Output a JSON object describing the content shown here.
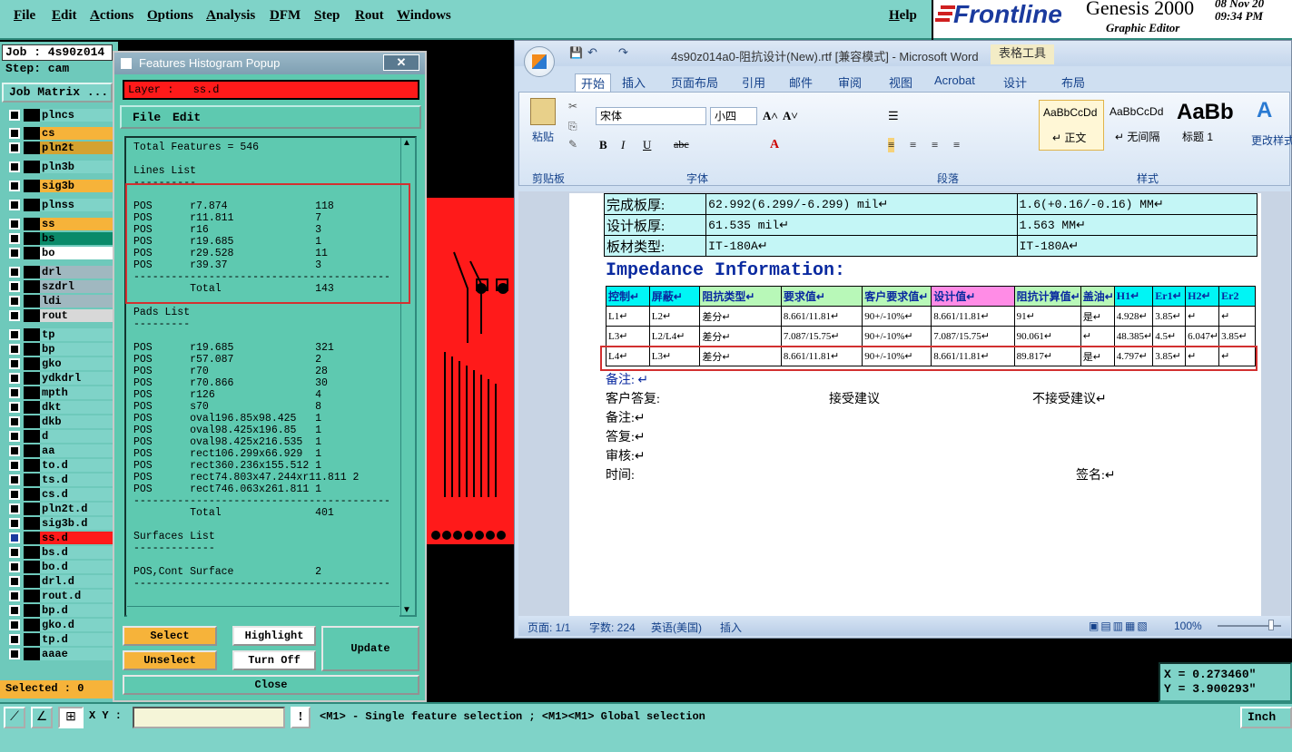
{
  "genesis": {
    "menu": [
      "File",
      "Edit",
      "Actions",
      "Options",
      "Analysis",
      "DFM",
      "Step",
      "Rout",
      "Windows"
    ],
    "help": "Help",
    "brand_logo": "Frontline",
    "brand_title": "Genesis 2000",
    "brand_subtitle": "Graphic Editor",
    "date": "08 Nov 20",
    "time": "09:34 PM",
    "job": "Job : 4s90z014",
    "step": "Step: cam",
    "job_matrix": "Job Matrix ...",
    "layers": [
      {
        "name": "plncs",
        "color": "#7fd3c8"
      },
      {
        "name": "cs",
        "color": "#f6b33a"
      },
      {
        "name": "pln2t",
        "color": "#d4a230"
      },
      {
        "name": "pln3b",
        "color": "#7fd3c8"
      },
      {
        "name": "sig3b",
        "color": "#f6b33a"
      },
      {
        "name": "plnss",
        "color": "#7fd3c8"
      },
      {
        "name": "ss",
        "color": "#f6b33a"
      },
      {
        "name": "bs",
        "color": "#0a8a6a"
      },
      {
        "name": "bo",
        "color": "#ffffff"
      },
      {
        "name": "drl",
        "color": "#a0b8c0"
      },
      {
        "name": "szdrl",
        "color": "#a0b8c0"
      },
      {
        "name": "ldi",
        "color": "#a0b8c0"
      },
      {
        "name": "rout",
        "color": "#d8d8d8"
      },
      {
        "name": "tp",
        "color": "#7fd3c8"
      },
      {
        "name": "bp",
        "color": "#7fd3c8"
      },
      {
        "name": "gko",
        "color": "#7fd3c8"
      },
      {
        "name": "ydkdrl",
        "color": "#7fd3c8"
      },
      {
        "name": "mpth",
        "color": "#7fd3c8"
      },
      {
        "name": "dkt",
        "color": "#7fd3c8"
      },
      {
        "name": "dkb",
        "color": "#7fd3c8"
      },
      {
        "name": "d",
        "color": "#7fd3c8"
      },
      {
        "name": "aa",
        "color": "#7fd3c8"
      },
      {
        "name": "to.d",
        "color": "#7fd3c8"
      },
      {
        "name": "ts.d",
        "color": "#7fd3c8"
      },
      {
        "name": "cs.d",
        "color": "#7fd3c8"
      },
      {
        "name": "pln2t.d",
        "color": "#7fd3c8"
      },
      {
        "name": "sig3b.d",
        "color": "#7fd3c8"
      },
      {
        "name": "ss.d",
        "color": "#ff1a1a"
      },
      {
        "name": "bs.d",
        "color": "#7fd3c8"
      },
      {
        "name": "bo.d",
        "color": "#7fd3c8"
      },
      {
        "name": "drl.d",
        "color": "#7fd3c8"
      },
      {
        "name": "rout.d",
        "color": "#7fd3c8"
      },
      {
        "name": "bp.d",
        "color": "#7fd3c8"
      },
      {
        "name": "gko.d",
        "color": "#7fd3c8"
      },
      {
        "name": "tp.d",
        "color": "#7fd3c8"
      },
      {
        "name": "aaae",
        "color": "#7fd3c8"
      }
    ],
    "selected": "Selected : 0",
    "xy_label": "X Y :",
    "status_msg": "<M1> - Single feature selection ; <M1><M1> Global selection",
    "units": "Inch",
    "coord_x": "X = 0.273460\"",
    "coord_y": "Y = 3.900293\""
  },
  "popup": {
    "title": "Features Histogram Popup",
    "layer_label": "Layer :",
    "layer_value": "ss.d",
    "menu": [
      "File",
      "Edit"
    ],
    "lines": [
      "Total Features = 546",
      "",
      "Lines List",
      "----------",
      "",
      "POS      r7.874              118",
      "POS      r11.811             7",
      "POS      r16                 3",
      "POS      r19.685             1",
      "POS      r29.528             11",
      "POS      r39.37              3",
      "-----------------------------------------",
      "         Total               143",
      "",
      "Pads List",
      "---------",
      "",
      "POS      r19.685             321",
      "POS      r57.087             2",
      "POS      r70                 28",
      "POS      r70.866             30",
      "POS      r126                4",
      "POS      s70                 8",
      "POS      oval196.85x98.425   1",
      "POS      oval98.425x196.85   1",
      "POS      oval98.425x216.535  1",
      "POS      rect106.299x66.929  1",
      "POS      rect360.236x155.512 1",
      "POS      rect74.803x47.244xr11.811 2",
      "POS      rect746.063x261.811 1",
      "-----------------------------------------",
      "         Total               401",
      "",
      "Surfaces List",
      "-------------",
      "",
      "POS,Cont Surface             2",
      "-----------------------------------------"
    ],
    "buttons": {
      "select": "Select",
      "highlight": "Highlight",
      "update": "Update",
      "unselect": "Unselect",
      "turn_off": "Turn Off",
      "close": "Close"
    }
  },
  "word": {
    "title": "4s90z014a0-阻抗设计(New).rtf [兼容模式] - Microsoft Word",
    "context_tab": "表格工具",
    "tabs": [
      "开始",
      "插入",
      "页面布局",
      "引用",
      "邮件",
      "审阅",
      "视图",
      "Acrobat",
      "设计",
      "布局"
    ],
    "font_name": "宋体",
    "font_size": "小四",
    "paste": "粘贴",
    "clipboard": "剪贴板",
    "font_group": "字体",
    "paragraph_group": "段落",
    "styles_group": "样式",
    "styles": [
      {
        "preview": "AaBbCcDd",
        "name": "↵ 正文"
      },
      {
        "preview": "AaBbCcDd",
        "name": "↵ 无间隔"
      },
      {
        "preview": "AaBb",
        "name": "标题 1"
      }
    ],
    "change_style": "更改样式",
    "info_rows": [
      [
        "完成板厚:",
        "62.992(6.299/-6.299) mil↵",
        "1.6(+0.16/-0.16) MM↵"
      ],
      [
        "设计板厚:",
        "61.535 mil↵",
        "1.563 MM↵"
      ],
      [
        "板材类型:",
        "IT-180A↵",
        "IT-180A↵"
      ]
    ],
    "heading": "Impedance Information:",
    "headers": [
      "控制↵",
      "屏蔽↵",
      "阻抗类型↵",
      "要求值↵",
      "客户要求值↵",
      "设计值↵",
      "阻抗计算值↵",
      "盖油↵",
      "H1↵",
      "Er1↵",
      "H2↵",
      "Er2"
    ],
    "rows": [
      [
        "L1↵",
        "L2↵",
        "差分↵",
        "8.661/11.81↵",
        "90+/-10%↵",
        "8.661/11.81↵",
        "91↵",
        "是↵",
        "4.928↵",
        "3.85↵",
        "↵",
        "↵"
      ],
      [
        "L3↵",
        "L2/L4↵",
        "差分↵",
        "7.087/15.75↵",
        "90+/-10%↵",
        "7.087/15.75↵",
        "90.061↵",
        "↵",
        "48.385↵",
        "4.5↵",
        "6.047↵",
        "3.85↵"
      ],
      [
        "L4↵",
        "L3↵",
        "差分↵",
        "8.661/11.81↵",
        "90+/-10%↵",
        "8.661/11.81↵",
        "89.817↵",
        "是↵",
        "4.797↵",
        "3.85↵",
        "↵",
        "↵"
      ]
    ],
    "notes": {
      "remark1": "备注: ↵",
      "customer_reply": "客户答复:",
      "accept": "接受建议",
      "reject": "不接受建议↵",
      "remark2": "备注:↵",
      "reply": "答复:↵",
      "review": "审核:↵",
      "time": "时间:",
      "sign": "签名:↵"
    },
    "status": {
      "page": "页面: 1/1",
      "words": "字数: 224",
      "lang": "英语(美国)",
      "mode": "插入",
      "zoom": "100%"
    }
  }
}
